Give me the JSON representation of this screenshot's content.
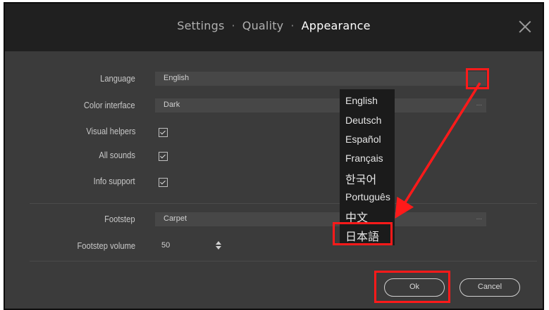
{
  "breadcrumb": {
    "item1": "Settings",
    "item2": "Quality",
    "item3": "Appearance",
    "separator": "·"
  },
  "close_icon": "close-icon",
  "fields": {
    "language": {
      "label": "Language",
      "value": "English"
    },
    "color_interface": {
      "label": "Color interface",
      "value": "Dark",
      "more": "..."
    },
    "visual_helpers": {
      "label": "Visual helpers",
      "checked": true
    },
    "all_sounds": {
      "label": "All sounds",
      "checked": true
    },
    "info_support": {
      "label": "Info support",
      "checked": true
    },
    "footstep": {
      "label": "Footstep",
      "value": "Carpet",
      "more": "..."
    },
    "footstep_volume": {
      "label": "Footstep volume",
      "value": "50"
    }
  },
  "language_dropdown": {
    "options": [
      "English",
      "Deutsch",
      "Español",
      "Français",
      "한국어",
      "Português",
      "中文",
      "日本語"
    ],
    "highlighted": "日本語"
  },
  "buttons": {
    "ok": "Ok",
    "cancel": "Cancel"
  },
  "annotations": {
    "color": "#ff1a1a"
  },
  "colors": {
    "background": "#3b3b3b",
    "titlebar": "#202020",
    "dropdown": "#1b1b1b"
  }
}
